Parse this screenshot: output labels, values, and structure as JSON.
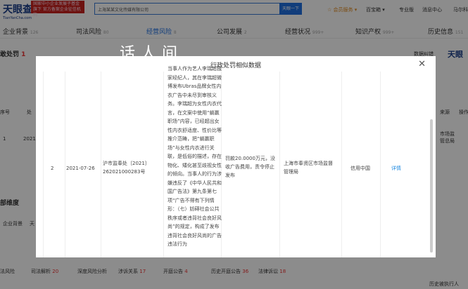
{
  "header": {
    "logo": "天眼查",
    "logo_sub": "TianYanCha.com",
    "ad_text": "国家中小企业发展子基金旗下 官方备案企业征信机构",
    "search_value": "上海某某文化传媒有限公司",
    "search_button": "天眼一下",
    "vip": "☆ 会员服务 ▾",
    "baobao": "百宝箱 ▾",
    "pro": "专业版",
    "messages": "消息中心",
    "user": "马尔科"
  },
  "nav": [
    {
      "label": "企业背景",
      "count": "126"
    },
    {
      "label": "司法风险",
      "count": "80"
    },
    {
      "label": "经营风险",
      "count": "8"
    },
    {
      "label": "公司发展",
      "count": "2"
    },
    {
      "label": "经营状况",
      "count": "999+"
    },
    {
      "label": "知识产权",
      "count": "999+"
    },
    {
      "label": "历史信息",
      "count": "151"
    }
  ],
  "background": {
    "section_title": "敢处罚",
    "section_count": "1",
    "feedback": "数据纠错",
    "brand": "天眼",
    "col_index": "序号",
    "col_num": "处",
    "col_source": "来源",
    "col_action": "操作",
    "row_index": "1",
    "row_date": "2021",
    "row_source": "市场监管总局",
    "dim": "部维度",
    "dim_item": "企业背景",
    "dim_item2": "天"
  },
  "watermark": "话人间",
  "modal": {
    "title": "行政处罚相似数据",
    "row": {
      "index": "2",
      "date": "2021-07-26",
      "number": "沪市监奉处〔2021〕262021000283号",
      "content": "当事人作为艺人李瑞超独家经纪人，其在李瑞超微博发布Ubras品牌女性内衣广告中未尽到审核义务。李瑞超为女性内衣代言，在文案中使用“躺赢职场”内容，已经超出女性内衣舒适度、性价比等推介范畴，把“躺赢职场”与女性内衣进行关联，是低俗的描述，存在物化、矮化甚至歧视女性的倾向。当事人的行为涉嫌违反了《中华人民共和国广告法》第九条第七项“广告不得有下列情形：（七）妨碍社会公共秩序或者违背社会良好风尚”的规定，构成了发布违背社会良好风尚的广告违法行为",
      "penalty": "罚款20.0000万元，没收广告费用，责令停止发布",
      "agency": "上海市奉贤区市场监督管理局",
      "source": "信用中国",
      "detail": "详情"
    }
  },
  "bottom": {
    "row1": [
      {
        "label": "法风险",
        "count": ""
      },
      {
        "label": "司法解析",
        "count": "20"
      },
      {
        "label": "深度风险分析",
        "count": ""
      },
      {
        "label": "涉诉关系",
        "count": "17"
      },
      {
        "label": "开庭公告",
        "count": "4"
      },
      {
        "label": "历史开庭公告",
        "count": "36"
      },
      {
        "label": "法律诉讼",
        "count": "18"
      }
    ],
    "history_exec": "历史被执行人"
  }
}
